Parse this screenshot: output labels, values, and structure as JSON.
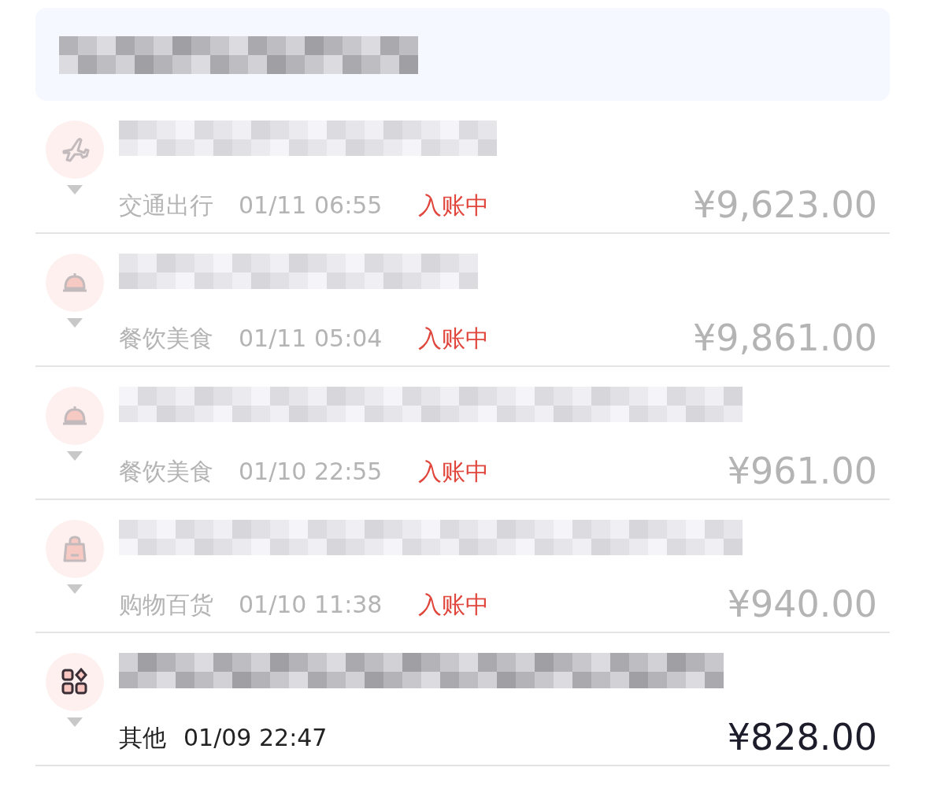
{
  "transactions": [
    {
      "kind": "plane",
      "category": "交通出行",
      "time": "01/11 06:55",
      "status": "入账中",
      "pending": true,
      "amount": "¥9,623.00"
    },
    {
      "kind": "cloche",
      "category": "餐饮美食",
      "time": "01/11 05:04",
      "status": "入账中",
      "pending": true,
      "amount": "¥9,861.00"
    },
    {
      "kind": "cloche",
      "category": "餐饮美食",
      "time": "01/10 22:55",
      "status": "入账中",
      "pending": true,
      "amount": "¥961.00"
    },
    {
      "kind": "bag",
      "category": "购物百货",
      "time": "01/10 11:38",
      "status": "入账中",
      "pending": true,
      "amount": "¥940.00"
    },
    {
      "kind": "grid",
      "category": "其他",
      "time": "01/09 22:47",
      "pending": false,
      "amount": "¥828.00"
    }
  ]
}
